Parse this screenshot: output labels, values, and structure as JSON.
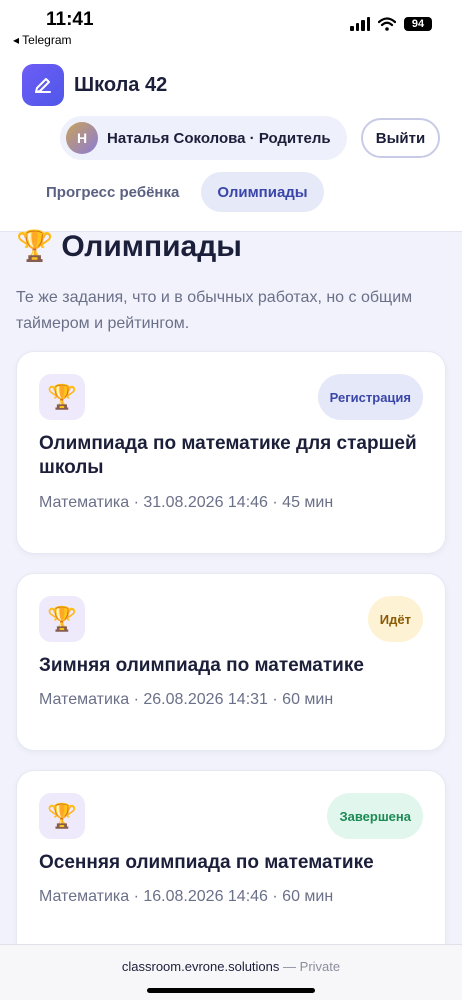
{
  "status_bar": {
    "time": "11:41",
    "back_app": "◂ Telegram",
    "battery": "94"
  },
  "header": {
    "app_title": "Школа 42",
    "user": {
      "initial": "Н",
      "label": "Наталья Соколова · Родитель"
    },
    "logout_label": "Выйти",
    "tabs": [
      {
        "label": "Прогресс ребёнка",
        "active": false
      },
      {
        "label": "Олимпиады",
        "active": true
      }
    ]
  },
  "page": {
    "title_icon": "🏆",
    "title": "Олимпиады",
    "description": "Те же задания, что и в обычных работах, но с общим таймером и рейтингом."
  },
  "olympiads": [
    {
      "icon": "🏆",
      "status": "Регистрация",
      "status_color": "#3a46a8",
      "name": "Олимпиада по математике для старшей школы",
      "meta": "Математика · 31.08.2026 14:46 · 45 мин"
    },
    {
      "icon": "🏆",
      "status": "Идёт",
      "status_color": "#8a5a05",
      "name": "Зимняя олимпиада по математике",
      "meta": "Математика · 26.08.2026 14:31 · 60 мин"
    },
    {
      "icon": "🏆",
      "status": "Завершена",
      "status_color": "#1c8a55",
      "name": "Осенняя олимпиада по математике",
      "meta": "Математика · 16.08.2026 14:46 · 60 мин"
    }
  ],
  "browser": {
    "url": "classroom.evrone.solutions",
    "private_label": "— Private"
  },
  "colors": {
    "accent": "#5b5ef0",
    "background": "#f1f2fb"
  }
}
